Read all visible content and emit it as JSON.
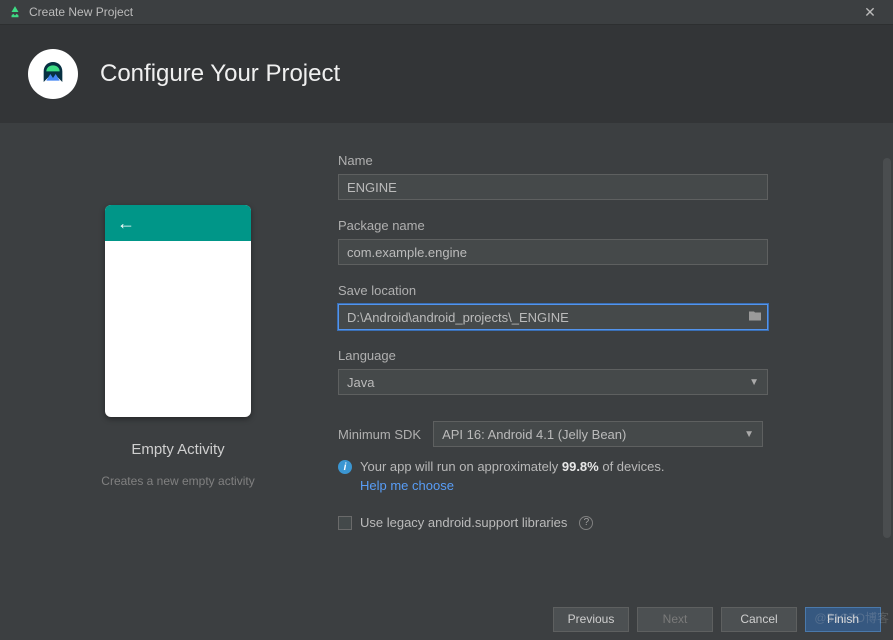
{
  "window": {
    "title": "Create New Project"
  },
  "header": {
    "title": "Configure Your Project"
  },
  "preview": {
    "template_name": "Empty Activity",
    "template_desc": "Creates a new empty activity"
  },
  "form": {
    "name_label": "Name",
    "name_value": "ENGINE",
    "package_label": "Package name",
    "package_value": "com.example.engine",
    "location_label": "Save location",
    "location_value": "D:\\Android\\android_projects\\_ENGINE",
    "language_label": "Language",
    "language_value": "Java",
    "minsdk_label": "Minimum SDK",
    "minsdk_value": "API 16: Android 4.1 (Jelly Bean)",
    "info_prefix": "Your app will run on approximately ",
    "info_percent": "99.8%",
    "info_suffix": " of devices.",
    "help_link": "Help me choose",
    "legacy_label": "Use legacy android.support libraries"
  },
  "buttons": {
    "previous": "Previous",
    "next": "Next",
    "cancel": "Cancel",
    "finish": "Finish"
  },
  "watermark": "@51CTO博客"
}
